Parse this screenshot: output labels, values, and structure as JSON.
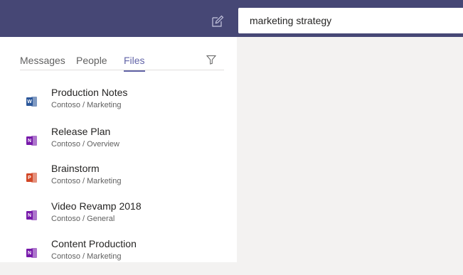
{
  "search": {
    "value": "marketing strategy"
  },
  "tabs": [
    {
      "label": "Messages",
      "active": false
    },
    {
      "label": "People",
      "active": false
    },
    {
      "label": "Files",
      "active": true
    }
  ],
  "files": [
    {
      "name": "Production Notes",
      "path": "Contoso / Marketing",
      "icon": "word-icon",
      "color": "#2b579a",
      "letter": "W"
    },
    {
      "name": "Release Plan",
      "path": "Contoso / Overview",
      "icon": "onenote-icon",
      "color": "#7719aa",
      "letter": "N"
    },
    {
      "name": "Brainstorm",
      "path": "Contoso / Marketing",
      "icon": "powerpoint-icon",
      "color": "#d24726",
      "letter": "P"
    },
    {
      "name": "Video Revamp 2018",
      "path": "Contoso / General",
      "icon": "onenote-icon",
      "color": "#7719aa",
      "letter": "N"
    },
    {
      "name": "Content Production",
      "path": "Contoso / Marketing",
      "icon": "onenote-icon",
      "color": "#7719aa",
      "letter": "N"
    }
  ],
  "colors": {
    "header": "#464775",
    "accent": "#6264a7"
  }
}
